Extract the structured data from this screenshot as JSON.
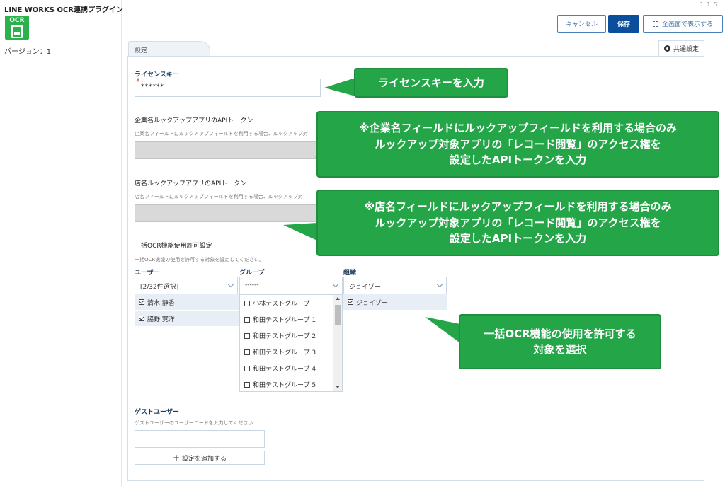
{
  "app": {
    "title": "LINE WORKS OCR連携プラグイン",
    "logo_text": "OCR",
    "version_label": "バージョン：1",
    "version_number": "1.1.5"
  },
  "toolbar": {
    "cancel_label": "キャンセル",
    "save_label": "保存",
    "fullscreen_label": "全画面で表示する"
  },
  "tabs": {
    "settings": "設定",
    "common_settings": "共通設定"
  },
  "form": {
    "license": {
      "label": "ライセンスキー",
      "value": "******"
    },
    "company_lookup": {
      "label": "企業名ルックアップアプリのAPIトークン",
      "description": "企業名フィールドにルックアップフィールドを利用する場合、ルックアップ対"
    },
    "store_lookup": {
      "label": "店名ルックアップアプリのAPIトークン",
      "description": "店名フィールドにルックアップフィールドを利用する場合、ルックアップ対"
    },
    "bulk_ocr": {
      "label": "一括OCR機能使用許可設定",
      "description": "一括OCR機能の使用を許可する対象を設定してください。",
      "users": {
        "header": "ユーザー",
        "selected": "[2/32件選択]",
        "items": [
          "清水 静香",
          "脇野 寛洋"
        ]
      },
      "groups": {
        "header": "グループ",
        "selected": "------",
        "options": [
          "小林テストグループ",
          "和田テストグループ 1",
          "和田テストグループ 2",
          "和田テストグループ 3",
          "和田テストグループ 4",
          "和田テストグループ 5"
        ]
      },
      "orgs": {
        "header": "組織",
        "selected": "ジョイゾー",
        "items": [
          "ジョイゾー"
        ]
      }
    },
    "guest": {
      "label": "ゲストユーザー",
      "description": "ゲストユーザーのユーザーコードを入力してください",
      "value": "",
      "add_label": "設定を追加する"
    }
  },
  "callouts": {
    "license": "ライセンスキーを入力",
    "company": [
      "※企業名フィールドにルックアップフィールドを利用する場合のみ",
      "ルックアップ対象アプリの「レコード閲覧」のアクセス権を",
      "設定したAPIトークンを入力"
    ],
    "store": [
      "※店名フィールドにルックアップフィールドを利用する場合のみ",
      "ルックアップ対象アプリの「レコード閲覧」のアクセス権を",
      "設定したAPIトークンを入力"
    ],
    "bulk": [
      "一括OCR機能の使用を許可する",
      "対象を選択"
    ]
  },
  "colors": {
    "callout_green": "#23a548",
    "primary_blue": "#0b4f9c"
  }
}
